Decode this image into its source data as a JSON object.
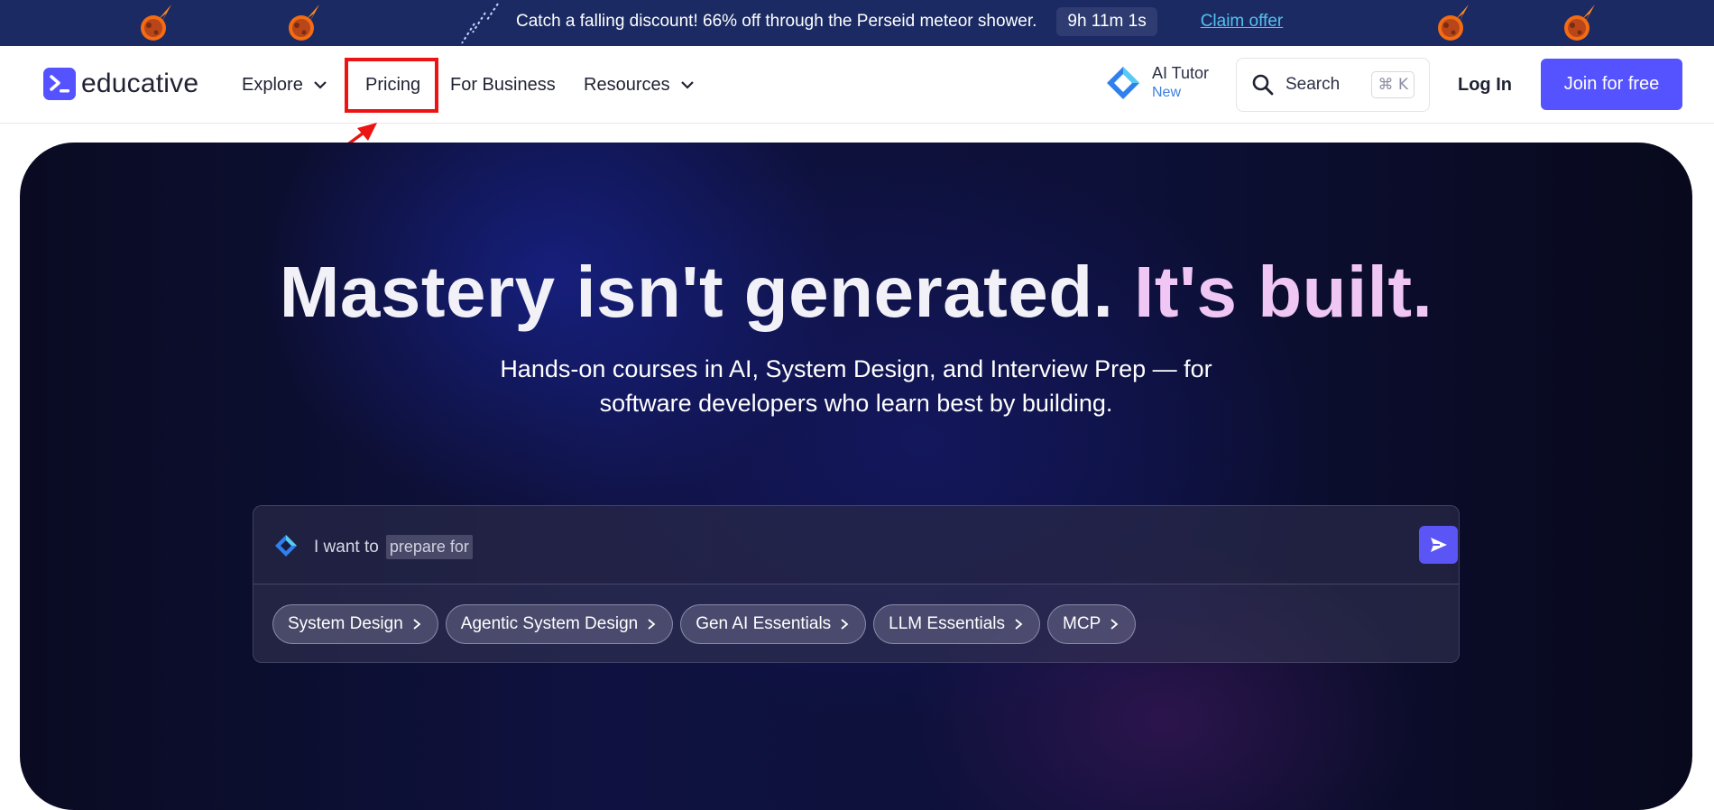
{
  "banner": {
    "message": "Catch a falling discount! 66% off through the Perseid meteor shower.",
    "countdown": "9h 11m 1s",
    "cta": "Claim offer"
  },
  "nav": {
    "logo_text": "educative",
    "items": [
      {
        "label": "Explore",
        "has_dropdown": true
      },
      {
        "label": "Pricing",
        "has_dropdown": false,
        "highlighted": true
      },
      {
        "label": "For Business",
        "has_dropdown": false
      },
      {
        "label": "Resources",
        "has_dropdown": true
      }
    ],
    "ai_tutor": {
      "label": "AI Tutor",
      "badge": "New"
    },
    "search": {
      "label": "Search",
      "shortcut": "⌘ K"
    },
    "login": "Log In",
    "join": "Join for free"
  },
  "hero": {
    "headline_main": "Mastery isn't generated.",
    "headline_accent": "It's built.",
    "subtitle_line1": "Hands-on courses in AI, System Design, and Interview Prep — for",
    "subtitle_line2": "software developers who learn best by building.",
    "prompt": {
      "prefix": "I want to",
      "chip": "prepare for"
    },
    "suggestions": [
      "System Design",
      "Agentic System Design",
      "Gen AI Essentials",
      "LLM Essentials",
      "MCP"
    ]
  },
  "colors": {
    "brand": "#5553ff",
    "banner_bg": "#1b2a63",
    "accent_text": "#f0c6f4",
    "annotation": "#ec1313",
    "link": "#55c1ee"
  }
}
